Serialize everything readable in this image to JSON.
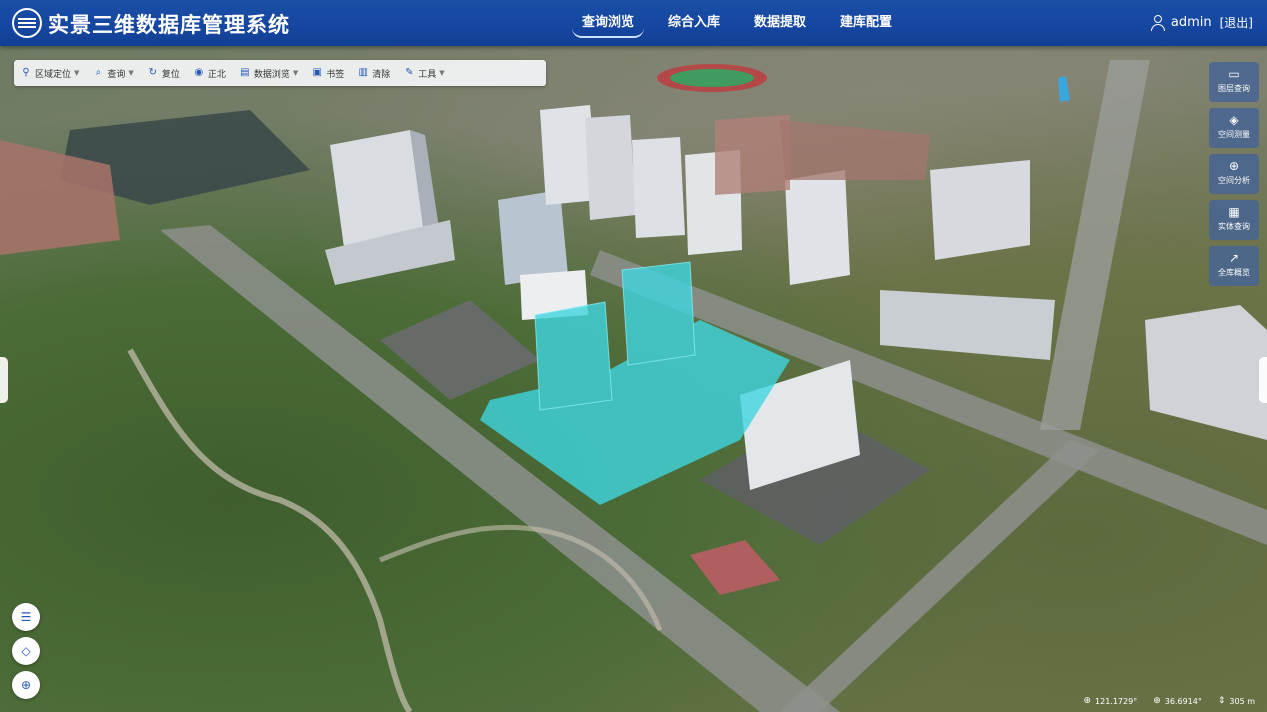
{
  "app": {
    "title": "实景三维数据库管理系统"
  },
  "nav": {
    "tabs": [
      {
        "label": "查询浏览",
        "active": true
      },
      {
        "label": "综合入库",
        "active": false
      },
      {
        "label": "数据提取",
        "active": false
      },
      {
        "label": "建库配置",
        "active": false
      }
    ]
  },
  "user": {
    "name": "admin",
    "logout": "[退出]"
  },
  "toolbar": {
    "region": "区域定位",
    "query": "查询",
    "reset": "复位",
    "north": "正北",
    "browse": "数据浏览",
    "bookmark": "书签",
    "clear": "清除",
    "tools": "工具"
  },
  "side": {
    "layer_query": "图层查询",
    "measure": "空间测量",
    "analysis": "空间分析",
    "entity_query": "实体查询",
    "overview": "全库概览"
  },
  "status": {
    "lon": "121.1729°",
    "lat": "36.6914°",
    "height": "305 m"
  },
  "colors": {
    "header": "#1546a0",
    "highlight": "#3fd6e0"
  }
}
